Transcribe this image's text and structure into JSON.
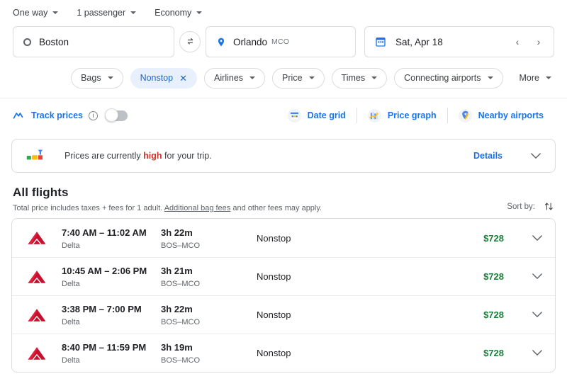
{
  "trip_options": [
    {
      "label": "One way",
      "name": "trip-type"
    },
    {
      "label": "1 passenger",
      "name": "passengers"
    },
    {
      "label": "Economy",
      "name": "cabin-class"
    }
  ],
  "search": {
    "origin": "Boston",
    "destination": "Orlando",
    "destination_code": "MCO",
    "date": "Sat, Apr 18",
    "prev_label": "‹",
    "next_label": "›"
  },
  "filters": [
    {
      "label": "Bags",
      "active": false
    },
    {
      "label": "Nonstop",
      "active": true
    },
    {
      "label": "Airlines",
      "active": false
    },
    {
      "label": "Price",
      "active": false
    },
    {
      "label": "Times",
      "active": false
    },
    {
      "label": "Connecting airports",
      "active": false
    },
    {
      "label": "More",
      "active": false
    }
  ],
  "tools": {
    "track_prices": "Track prices",
    "date_grid": "Date grid",
    "price_graph": "Price graph",
    "nearby_airports": "Nearby airports"
  },
  "banner": {
    "text_before": "Prices are currently ",
    "highlight": "high",
    "text_after": " for your trip.",
    "details": "Details"
  },
  "section": {
    "title": "All flights",
    "subtitle_before": "Total price includes taxes + fees for 1 adult. ",
    "subtitle_link": "Additional bag fees",
    "subtitle_after": " and other fees may apply.",
    "sort_by": "Sort by:"
  },
  "flights": [
    {
      "times": "7:40 AM – 11:02 AM",
      "airline": "Delta",
      "duration": "3h 22m",
      "route": "BOS–MCO",
      "stops": "Nonstop",
      "price": "$728"
    },
    {
      "times": "10:45 AM – 2:06 PM",
      "airline": "Delta",
      "duration": "3h 21m",
      "route": "BOS–MCO",
      "stops": "Nonstop",
      "price": "$728"
    },
    {
      "times": "3:38 PM – 7:00 PM",
      "airline": "Delta",
      "duration": "3h 22m",
      "route": "BOS–MCO",
      "stops": "Nonstop",
      "price": "$728"
    },
    {
      "times": "8:40 PM – 11:59 PM",
      "airline": "Delta",
      "duration": "3h 19m",
      "route": "BOS–MCO",
      "stops": "Nonstop",
      "price": "$728"
    }
  ],
  "colors": {
    "accent_blue": "#1a73e8",
    "chip_active_bg": "#e8f0fe",
    "price_green": "#188038",
    "alert_red": "#d93025",
    "delta_red": "#c8102e"
  }
}
